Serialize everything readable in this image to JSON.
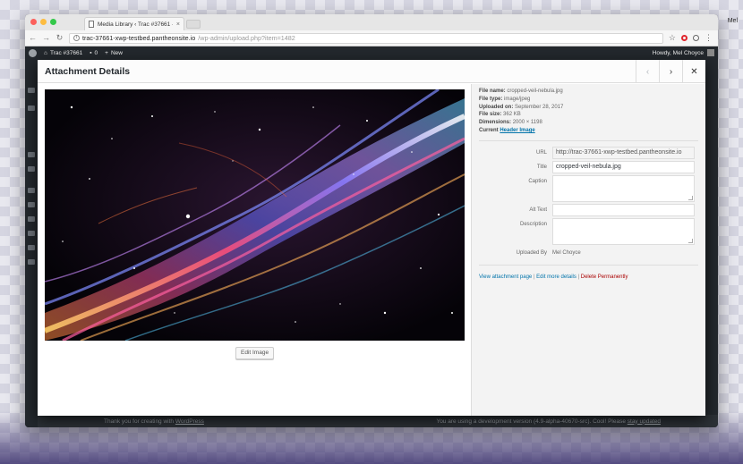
{
  "os": {
    "user_name": "Mel"
  },
  "browser": {
    "tab_title": "Media Library ‹ Trac #37661 -",
    "tab_close": "×",
    "url_host": "trac-37661-xwp-testbed.pantheonsite.io",
    "url_path": "/wp-admin/upload.php?item=1482"
  },
  "adminbar": {
    "site_name": "Trac #37661",
    "comments_count": "0",
    "new_label": "New",
    "howdy": "Howdy, Mel Choyce"
  },
  "modal": {
    "title": "Attachment Details",
    "edit_image_label": "Edit Image",
    "meta": {
      "file_name_label": "File name:",
      "file_name": "cropped-veil-nebula.jpg",
      "file_type_label": "File type:",
      "file_type": "image/jpeg",
      "uploaded_on_label": "Uploaded on:",
      "uploaded_on": "September 28, 2017",
      "file_size_label": "File size:",
      "file_size": "362 KB",
      "dimensions_label": "Dimensions:",
      "dimensions": "2000 × 1198",
      "current_label": "Current",
      "current_link": "Header Image"
    },
    "fields": {
      "url_label": "URL",
      "url_value": "http://trac-37661-xwp-testbed.pantheonsite.io",
      "title_label": "Title",
      "title_value": "cropped-veil-nebula.jpg",
      "caption_label": "Caption",
      "alt_label": "Alt Text",
      "description_label": "Description",
      "uploaded_by_label": "Uploaded By",
      "uploaded_by_value": "Mel Choyce"
    },
    "links": {
      "view": "View attachment page",
      "edit": "Edit more details",
      "delete": "Delete Permanently",
      "separator": "|"
    }
  },
  "footer": {
    "thanks_prefix": "Thank you for creating with",
    "thanks_link": "WordPress",
    "version_text": "You are using a development version (4.9-alpha-40670-src). Cool! Please",
    "version_link": "stay updated"
  },
  "colors": {
    "wp_dark": "#23282d",
    "link_blue": "#0073aa",
    "delete_red": "#aa0000"
  }
}
